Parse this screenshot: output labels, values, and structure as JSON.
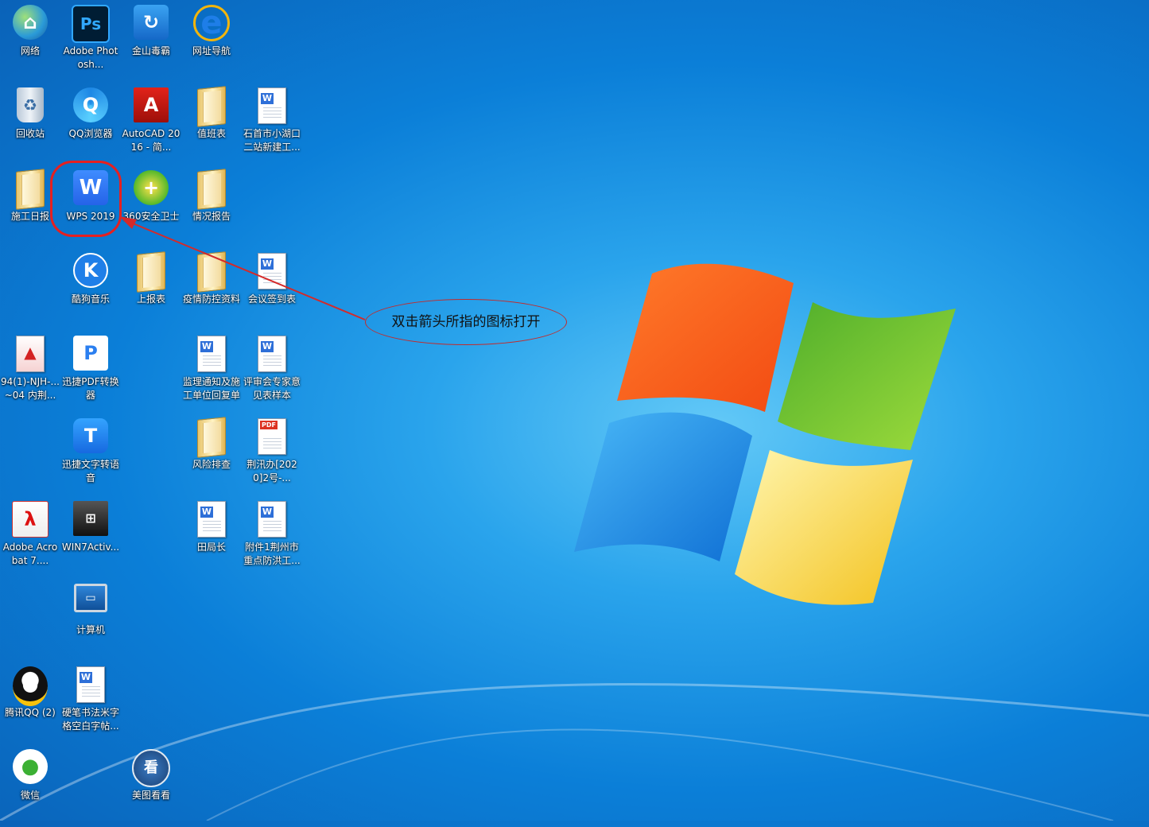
{
  "desktop": {
    "icons": [
      {
        "label": "网络",
        "icon": "network-icon"
      },
      {
        "label": "Adobe Photosh...",
        "icon": "photoshop-icon"
      },
      {
        "label": "金山毒霸",
        "icon": "jinshan-duba-icon"
      },
      {
        "label": "网址导航",
        "icon": "ie-icon"
      },
      {
        "label": "回收站",
        "icon": "recycle-bin-icon"
      },
      {
        "label": "QQ浏览器",
        "icon": "qq-browser-icon"
      },
      {
        "label": "AutoCAD 2016 - 简...",
        "icon": "autocad-icon"
      },
      {
        "label": "值班表",
        "icon": "folder-icon"
      },
      {
        "label": "石首市小湖口二站新建工...",
        "icon": "word-doc-icon"
      },
      {
        "label": "施工日报",
        "icon": "folder-icon"
      },
      {
        "label": "WPS 2019",
        "icon": "wps-icon"
      },
      {
        "label": "360安全卫士",
        "icon": "360-safe-icon"
      },
      {
        "label": "情况报告",
        "icon": "folder-icon"
      },
      {
        "label": "酷狗音乐",
        "icon": "kugou-icon"
      },
      {
        "label": "上报表",
        "icon": "folder-icon"
      },
      {
        "label": "疫情防控资料",
        "icon": "folder-icon"
      },
      {
        "label": "会议签到表",
        "icon": "word-doc-icon"
      },
      {
        "label": "94(1)-NJH-...~04 内荆...",
        "icon": "pdf-red-icon"
      },
      {
        "label": "迅捷PDF转换器",
        "icon": "xunjie-pdf-icon"
      },
      {
        "label": "监理通知及施工单位回复单",
        "icon": "word-doc-icon"
      },
      {
        "label": "评审会专家意见表样本",
        "icon": "word-doc-icon"
      },
      {
        "label": "迅捷文字转语音",
        "icon": "xunjie-voice-icon"
      },
      {
        "label": "风险排查",
        "icon": "folder-icon"
      },
      {
        "label": "荆汛办[2020]2号-...",
        "icon": "pdf-doc-icon"
      },
      {
        "label": "Adobe Acrobat 7....",
        "icon": "acrobat-icon"
      },
      {
        "label": "WIN7Activ...",
        "icon": "win7-activator-icon"
      },
      {
        "label": "田局长",
        "icon": "word-doc-icon"
      },
      {
        "label": "附件1荆州市重点防洪工...",
        "icon": "word-doc-icon"
      },
      {
        "label": "计算机",
        "icon": "computer-icon"
      },
      {
        "label": "腾讯QQ (2)",
        "icon": "qq-icon"
      },
      {
        "label": "硬笔书法米字格空白字帖...",
        "icon": "word-doc-icon"
      },
      {
        "label": "微信",
        "icon": "wechat-icon"
      },
      {
        "label": "美图看看",
        "icon": "meitu-kankan-icon"
      }
    ]
  },
  "annotation": {
    "callout_text": "双击箭头所指的图标打开",
    "color": "#c42a2a"
  }
}
